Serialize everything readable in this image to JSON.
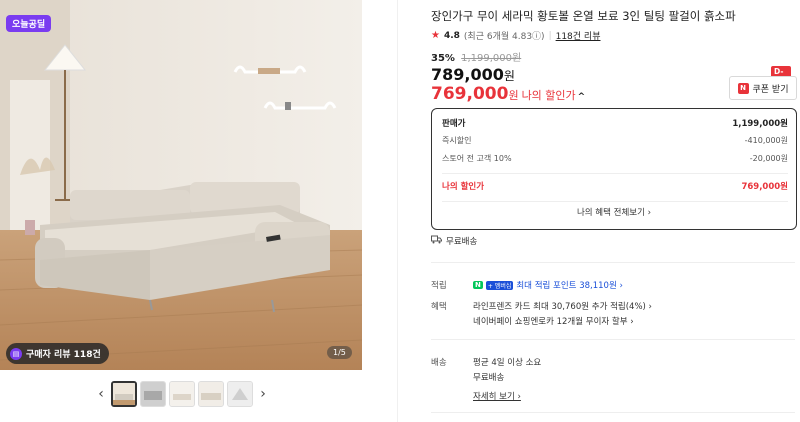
{
  "gallery": {
    "brand_badge": "오늘공딜",
    "review_pill": "구매자 리뷰 118건",
    "counter": "1/5",
    "prev_icon": "‹",
    "next_icon": "›"
  },
  "product": {
    "title": "장인가구 무이 세라믹 황토볼 온열 보료 3인 틸팅 팔걸이 흙소파",
    "rating_score": "4.8",
    "rating_sub": "(최근 6개월 4.83ⓘ)",
    "rating_sep": "|",
    "review_link": "118건 리뷰",
    "discount_pct": "35%",
    "original_price": "1,199,000원",
    "price_value": "789,000",
    "price_unit": "원",
    "my_price_value": "769,000",
    "my_price_unit": "원",
    "my_price_label": "나의 할인가",
    "caret": "^"
  },
  "coupon": {
    "dday": "D-1",
    "icon": "N",
    "label": "쿠폰 받기"
  },
  "price_box": {
    "rows": [
      {
        "label": "판매가",
        "value": "1,199,000원"
      },
      {
        "label": "즉시할인",
        "value": "-410,000원"
      },
      {
        "label": "스토어 전 고객 10%",
        "value": "-20,000원"
      },
      {
        "label": "나의 할인가",
        "value": "769,000원"
      }
    ],
    "benefits_link": "나의 혜택 전체보기 ›"
  },
  "shipping_tag": "무료배송",
  "info": {
    "point": {
      "key": "적립",
      "n_icon": "N",
      "plus_icon": "+ 멤버십",
      "text": "최대 적립 포인트 38,110원 ›"
    },
    "benefit": {
      "key": "혜택",
      "line1": "라인프렌즈 카드 최대 30,760원 추가 적립(4%) ›",
      "line2": "네이버페이 쇼핑엔로카 12개월 무이자 할부 ›"
    },
    "delivery": {
      "key": "배송",
      "line1": "평균 4일 이상 소요",
      "line2": "무료배송",
      "detail_link": "자세히 보기 ›"
    }
  },
  "colors": {
    "accent_red": "#e8333a",
    "brand_purple": "#7a3cf0",
    "npay_green": "#03c75a"
  }
}
